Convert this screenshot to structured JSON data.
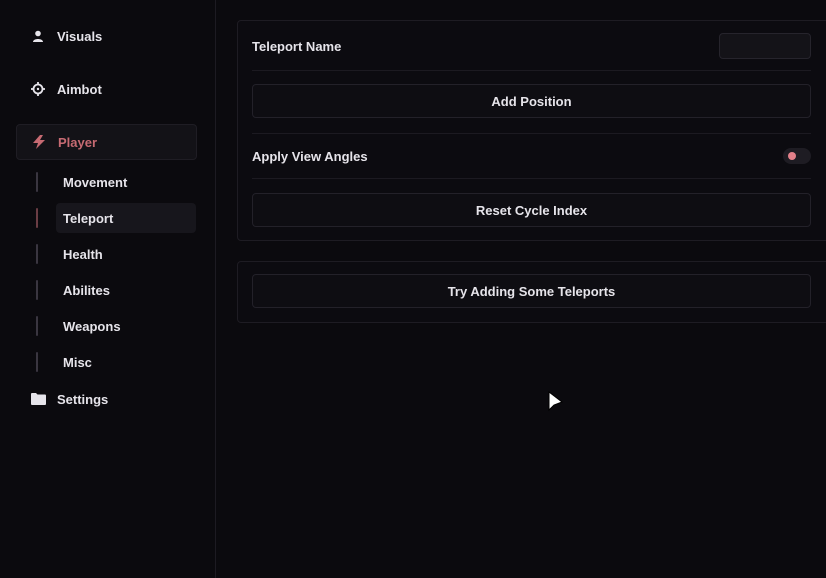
{
  "sidebar": {
    "items": [
      {
        "label": "Visuals",
        "icon": "user-icon"
      },
      {
        "label": "Aimbot",
        "icon": "crosshair-icon"
      },
      {
        "label": "Player",
        "icon": "bolt-icon"
      },
      {
        "label": "Settings",
        "icon": "folder-icon"
      }
    ],
    "player_sub": [
      {
        "label": "Movement"
      },
      {
        "label": "Teleport"
      },
      {
        "label": "Health"
      },
      {
        "label": "Abilites"
      },
      {
        "label": "Weapons"
      },
      {
        "label": "Misc"
      }
    ]
  },
  "teleport_panel": {
    "name_label": "Teleport Name",
    "name_value": "",
    "add_position_label": "Add Position",
    "apply_view_angles_label": "Apply View Angles",
    "apply_view_angles_on": false,
    "reset_cycle_label": "Reset Cycle Index"
  },
  "teleports_panel": {
    "empty_label": "Try Adding Some Teleports"
  },
  "colors": {
    "accent": "#c66a72",
    "toggle_knob": "#e3808a",
    "background": "#0b0a0e"
  }
}
